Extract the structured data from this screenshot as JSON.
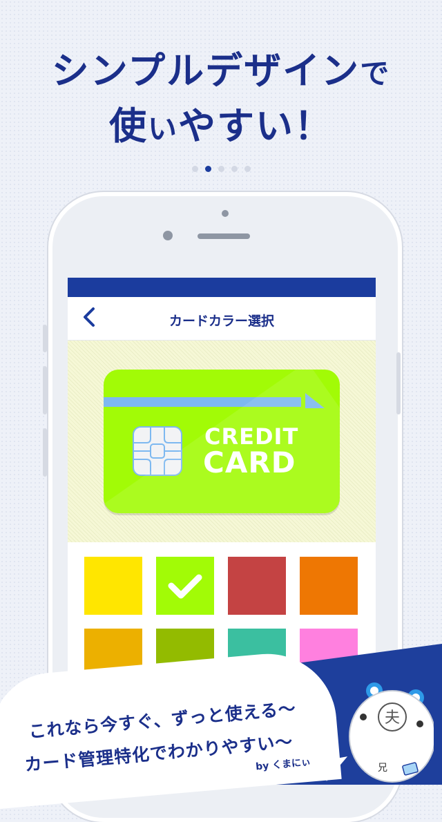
{
  "headline": {
    "line1_main": "シンプルデザイン",
    "line1_tail": "で",
    "line2_main": "使",
    "line2_small": "い",
    "line2_rest": "やすい！"
  },
  "pager": {
    "total": 5,
    "active_index": 1
  },
  "app": {
    "nav_title": "カードカラー選択",
    "back_label": "〈",
    "card": {
      "line1": "CREDIT",
      "line2": "CARD",
      "color": "#a2fb06"
    },
    "swatch_colors": [
      "#ffe600",
      "#a2fb06",
      "#c44343",
      "#ee7703",
      "#ecb000",
      "#93bb00",
      "#3bbfa0",
      "#ff80df"
    ],
    "selected_index": 1
  },
  "catchphrase": {
    "line1": "これなら今すぐ、ずっと使える〜",
    "line2": "カード管理特化でわかりやすい〜",
    "by": "by くまにぃ"
  },
  "mascot": {
    "face_char": "夫",
    "badge": "兄"
  },
  "colors": {
    "brand": "#1b3c9e",
    "text": "#1b2f8a"
  }
}
